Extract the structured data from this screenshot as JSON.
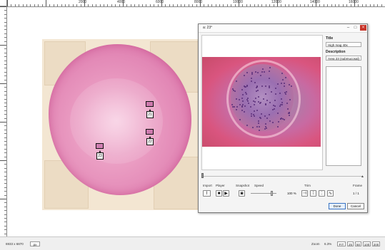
{
  "ruler": {
    "labels": [
      "2000",
      "4000",
      "6000",
      "8000",
      "10000",
      "12000",
      "14000",
      "16000"
    ]
  },
  "markers": [
    {
      "label": "21"
    },
    {
      "label": "22"
    },
    {
      "label": "23"
    }
  ],
  "dialog": {
    "title": "a: 23°",
    "side": {
      "title_label": "Title",
      "title_value": "High mag 40x",
      "description_label": "Description",
      "description_value": "Area 23 (submucosal)"
    },
    "controls": {
      "input_label": "Import",
      "player_label": "Player",
      "snapshot_label": "Snapshot",
      "speed_label": "Speed",
      "trim_label": "Trim",
      "frame_label": "Frame",
      "speed_value": "100 %",
      "frame_value": "1 / 1",
      "speed_level": 0.8
    },
    "buttons": {
      "done": "Done",
      "cancel": "Cancel"
    }
  },
  "status": {
    "coords": "6933 x 6870",
    "unit": "px",
    "zoom_label": "Zoom",
    "zoom_value": "6.3%",
    "fit": "FIT",
    "z25": "25",
    "z50": "50",
    "z100": "100",
    "z200": "200"
  }
}
